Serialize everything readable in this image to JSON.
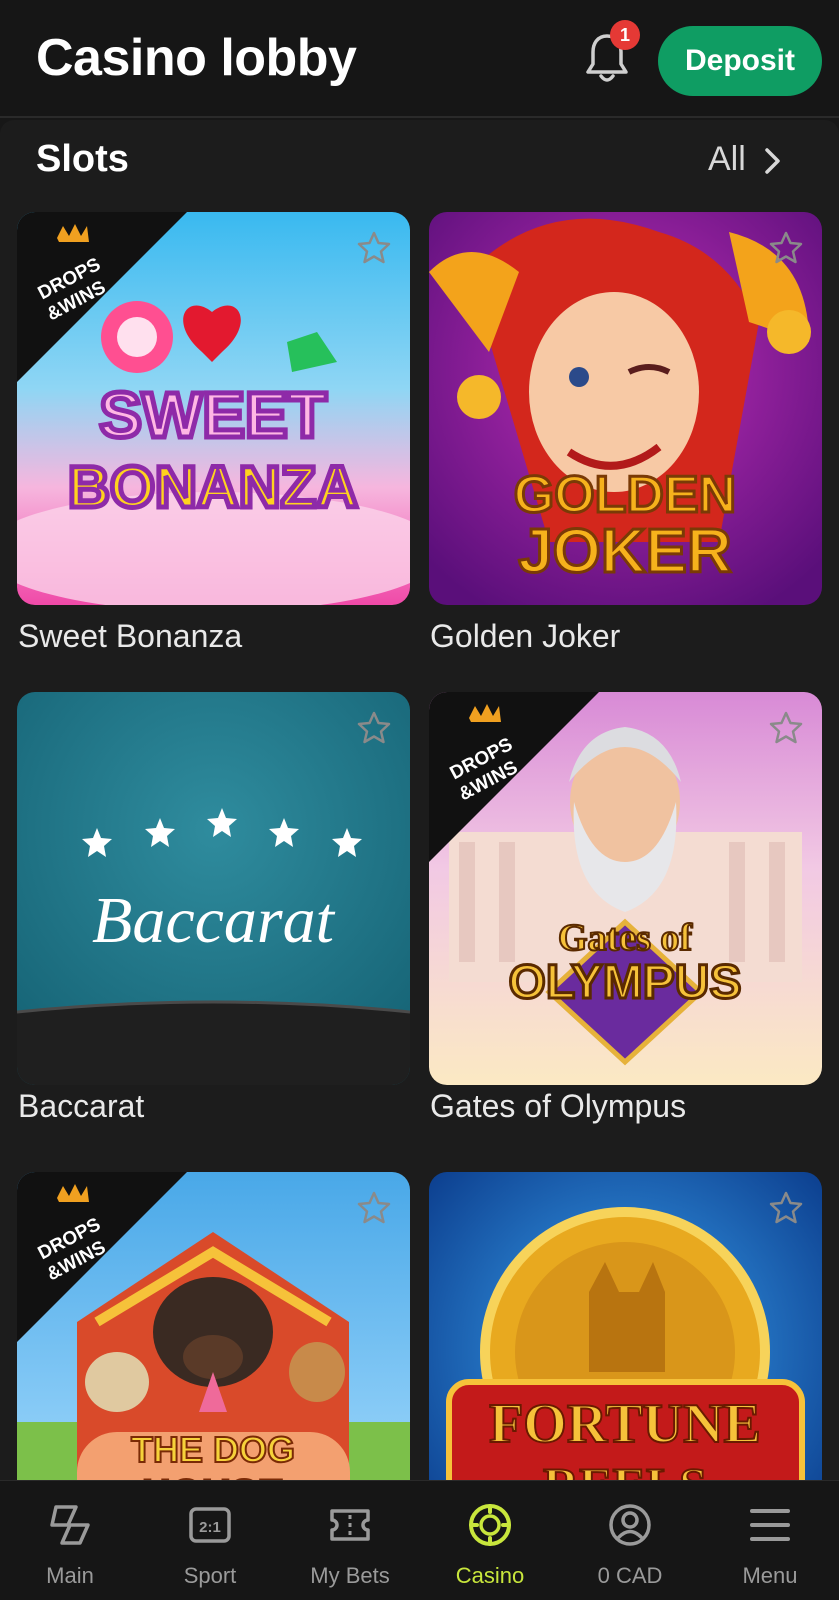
{
  "header": {
    "title": "Casino lobby",
    "notification_count": "1",
    "deposit_label": "Deposit"
  },
  "section": {
    "title": "Slots",
    "all_label": "All"
  },
  "games": [
    {
      "title": "Sweet Bonanza",
      "art_line1": "SWEET",
      "art_line2": "BONANZA",
      "badge": "DROPS & WINS"
    },
    {
      "title": "Golden Joker",
      "art_line1": "GOLDEN",
      "art_line2": "JOKER"
    },
    {
      "title": "Baccarat",
      "art_line1": "Baccarat"
    },
    {
      "title": "Gates of Olympus",
      "art_line1": "Gates of",
      "art_line2": "OLYMPUS",
      "badge": "DROPS & WINS"
    },
    {
      "title": "The Dog House",
      "art_line1": "THE DOG",
      "art_line2": "HOUSE",
      "badge": "DROPS & WINS"
    },
    {
      "title": "Fortune Reels",
      "art_line1": "FORTUNE",
      "art_line2": "REELS"
    }
  ],
  "ribbon_text": {
    "line1": "DROPS",
    "line2": "&WINS"
  },
  "nav": [
    {
      "label": "Main",
      "icon": "main-icon"
    },
    {
      "label": "Sport",
      "icon": "sport-icon",
      "icon_text": "2:1"
    },
    {
      "label": "My Bets",
      "icon": "ticket-icon"
    },
    {
      "label": "Casino",
      "icon": "casino-chip-icon",
      "active": true
    },
    {
      "label": "0 CAD",
      "icon": "account-icon"
    },
    {
      "label": "Menu",
      "icon": "menu-icon"
    }
  ],
  "colors": {
    "background": "#171717",
    "deposit": "#0f9d63",
    "active_nav": "#c8e63c",
    "badge": "#e53935"
  }
}
